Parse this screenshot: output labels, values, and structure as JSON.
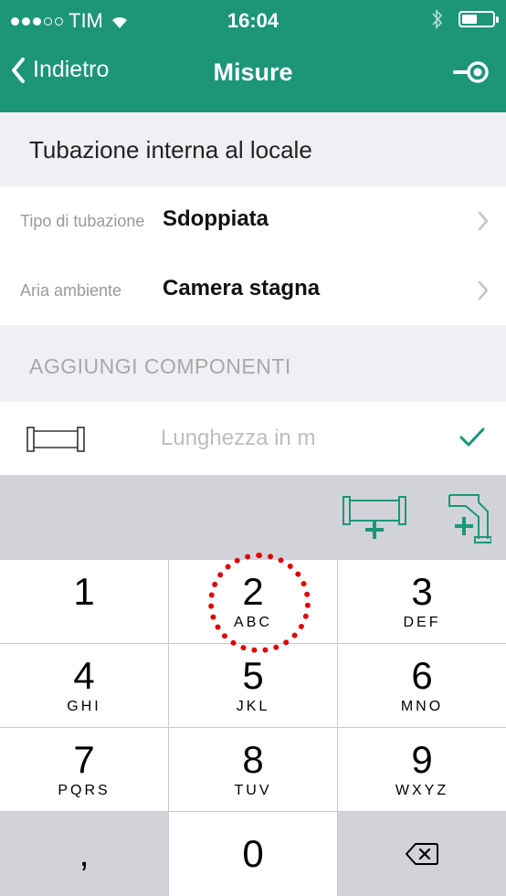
{
  "status_bar": {
    "carrier": "TIM",
    "time": "16:04"
  },
  "nav": {
    "back_label": "Indietro",
    "title": "Misure",
    "action_icon": "pipe-connector-icon"
  },
  "section": {
    "title": "Tubazione interna al locale"
  },
  "rows": [
    {
      "label": "Tipo di tubazione",
      "value": "Sdoppiata"
    },
    {
      "label": "Aria ambiente",
      "value": "Camera stagna"
    }
  ],
  "add_components": {
    "title": "AGGIUNGI COMPONENTI"
  },
  "length_input": {
    "value": "",
    "placeholder": "Lunghezza in m"
  },
  "keypad": {
    "keys": [
      {
        "num": "1",
        "letters": ""
      },
      {
        "num": "2",
        "letters": "ABC"
      },
      {
        "num": "3",
        "letters": "DEF"
      },
      {
        "num": "4",
        "letters": "GHI"
      },
      {
        "num": "5",
        "letters": "JKL"
      },
      {
        "num": "6",
        "letters": "MNO"
      },
      {
        "num": "7",
        "letters": "PQRS"
      },
      {
        "num": "8",
        "letters": "TUV"
      },
      {
        "num": "9",
        "letters": "WXYZ"
      },
      {
        "num": ",",
        "letters": ""
      },
      {
        "num": "0",
        "letters": ""
      }
    ]
  },
  "colors": {
    "brand_green": "#1c9579",
    "section_bg": "#efeff4",
    "highlight": "#e00000"
  }
}
